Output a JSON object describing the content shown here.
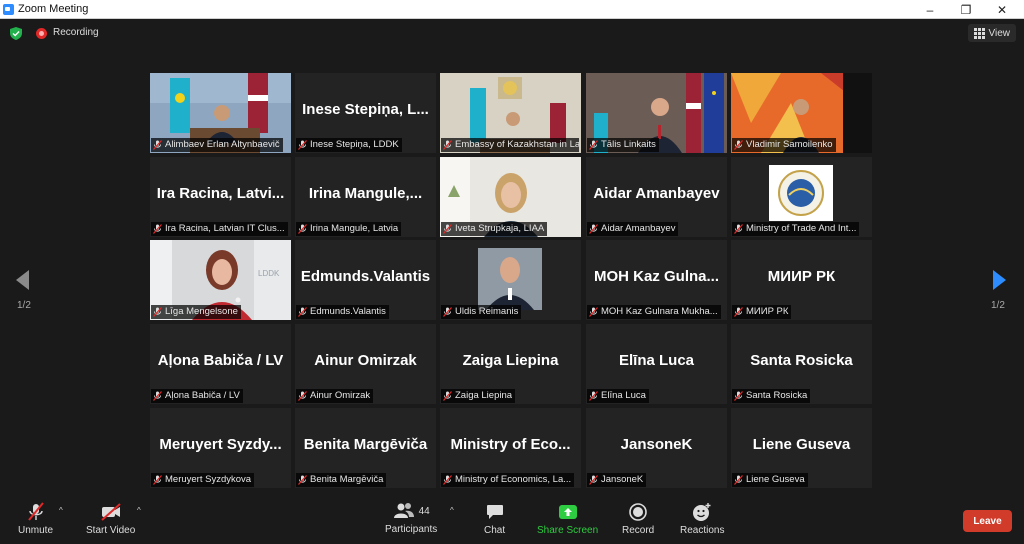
{
  "window": {
    "title": "Zoom Meeting"
  },
  "topbar": {
    "recording_label": "Recording",
    "view_label": "View"
  },
  "nav": {
    "left_page": "1/2",
    "right_page": "1/2"
  },
  "tiles": [
    {
      "name": "Alimbaev Erlan Altynbaevič",
      "display": "",
      "video": "flags-man"
    },
    {
      "name": "Inese Stepiņa, LDDK",
      "display": "Inese Stepiņa, L...",
      "video": ""
    },
    {
      "name": "Embassy of Kazakhstan in La...",
      "display": "",
      "video": "embassy"
    },
    {
      "name": "Tālis Linkaits",
      "display": "",
      "video": "flags-man2"
    },
    {
      "name": "Vladimir Samoilenko",
      "display": "",
      "video": "orange-bg"
    },
    {
      "name": "Ira Racina, Latvian IT Clus...",
      "display": "Ira Racina, Latvi...",
      "video": ""
    },
    {
      "name": "Irina Mangule, Latvia",
      "display": "Irina Mangule,...",
      "video": ""
    },
    {
      "name": "Iveta Strupkaja, LIAA",
      "display": "",
      "video": "woman-light"
    },
    {
      "name": "Aidar Amanbayev",
      "display": "Aidar Amanbayev",
      "video": ""
    },
    {
      "name": "Ministry of Trade And Int...",
      "display": "",
      "video": "logo"
    },
    {
      "name": "Līga Mengelsone",
      "display": "",
      "video": "woman-red"
    },
    {
      "name": "Edmunds.Valantis",
      "display": "Edmunds.Valantis",
      "video": ""
    },
    {
      "name": "Uldis Reimanis",
      "display": "",
      "video": "man-photo"
    },
    {
      "name": "МОН Kaz Gulnara Mukha...",
      "display": "МОН Kaz Gulna...",
      "video": ""
    },
    {
      "name": "МИИР РК",
      "display": "МИИР РК",
      "video": ""
    },
    {
      "name": "Aļona Babiča / LV",
      "display": "Aļona Babiča / LV",
      "video": ""
    },
    {
      "name": "Ainur Omirzak",
      "display": "Ainur Omirzak",
      "video": ""
    },
    {
      "name": "Zaiga Liepina",
      "display": "Zaiga Liepina",
      "video": ""
    },
    {
      "name": "Elīna Luca",
      "display": "Elīna Luca",
      "video": ""
    },
    {
      "name": "Santa Rosicka",
      "display": "Santa Rosicka",
      "video": ""
    },
    {
      "name": "Meruyert Syzdykova",
      "display": "Meruyert Syzdy...",
      "video": ""
    },
    {
      "name": "Benita Margēviča",
      "display": "Benita Margēviča",
      "video": ""
    },
    {
      "name": "Ministry of Economics, La...",
      "display": "Ministry of Eco...",
      "video": ""
    },
    {
      "name": "JansoneK",
      "display": "JansoneK",
      "video": ""
    },
    {
      "name": "Liene Guseva",
      "display": "Liene Guseva",
      "video": ""
    }
  ],
  "toolbar": {
    "unmute": "Unmute",
    "start_video": "Start Video",
    "participants": "Participants",
    "participants_count": "44",
    "chat": "Chat",
    "share_screen": "Share Screen",
    "record": "Record",
    "reactions": "Reactions",
    "leave": "Leave"
  },
  "colors": {
    "accent_green": "#2ecc40",
    "leave_red": "#d13b2a",
    "active_speaker": "#c6d96b",
    "arrow_blue": "#2d8cff"
  }
}
